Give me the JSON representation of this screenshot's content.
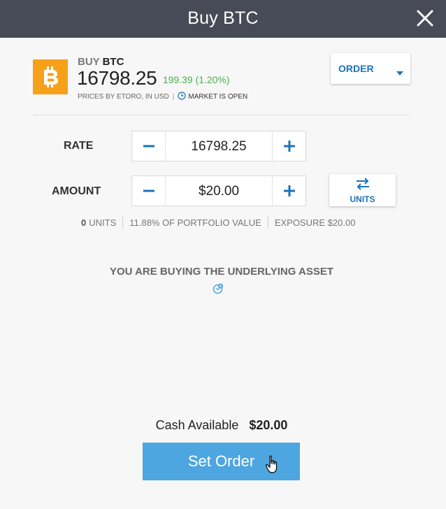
{
  "header": {
    "title": "Buy BTC",
    "close_icon": "close-icon"
  },
  "asset": {
    "buy_prefix": "BUY",
    "symbol": "BTC",
    "price": "16798.25",
    "change": "199.39 (1.20%)",
    "change_color": "#4caf50",
    "logo_color": "#f7a11a",
    "prices_by": "PRICES BY ETORO, IN USD",
    "separator": "|",
    "market_status": "MARKET IS OPEN"
  },
  "order_type": {
    "label": "ORDER"
  },
  "rate": {
    "label": "RATE",
    "value": "16798.25"
  },
  "amount": {
    "label": "AMOUNT",
    "value": "$20.00"
  },
  "units_toggle": {
    "label": "UNITS"
  },
  "stats": {
    "units_count": "0",
    "units_label": "UNITS",
    "portfolio": "11.88% OF PORTFOLIO VALUE",
    "exposure": "EXPOSURE $20.00"
  },
  "notice": "YOU ARE BUYING THE UNDERLYING ASSET",
  "cash": {
    "label": "Cash Available",
    "amount": "$20.00"
  },
  "submit": {
    "label": "Set Order"
  },
  "colors": {
    "accent": "#1a73b8",
    "button": "#4da6e0",
    "header_bg": "#474b57"
  }
}
